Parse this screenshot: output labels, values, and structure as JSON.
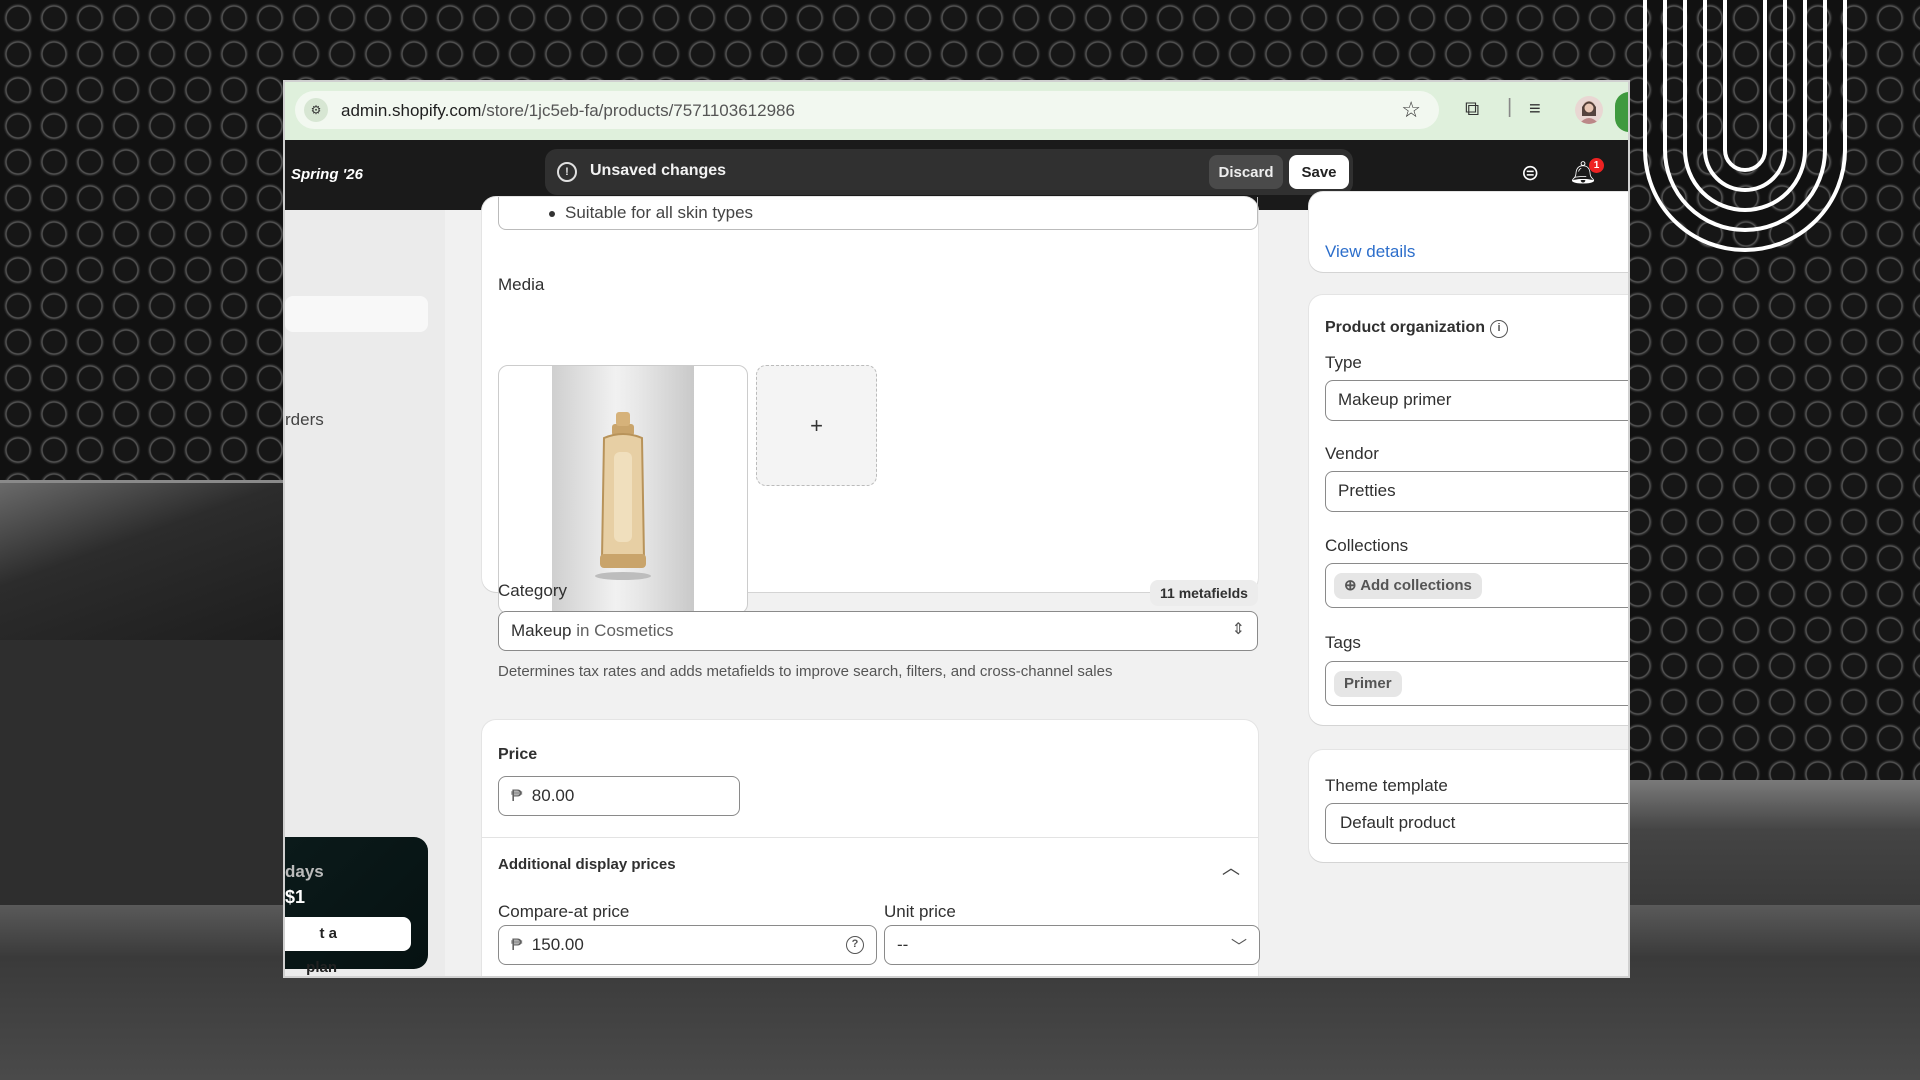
{
  "browser": {
    "url_domain": "admin.shopify.com",
    "url_path": "/store/1jc5eb-fa/products/7571103612986"
  },
  "topbar": {
    "brand": "Spring '26",
    "save_bar": {
      "message": "Unsaved changes",
      "discard_label": "Discard",
      "save_label": "Save"
    },
    "notification_count": "1"
  },
  "sidebar": {
    "orders_label": "rders",
    "trial": {
      "days_text": "days",
      "price_text": "$1",
      "button_label": "t a plan"
    }
  },
  "description": {
    "last_bullet": "Suitable for all skin types"
  },
  "media": {
    "label": "Media",
    "add_symbol": "+"
  },
  "category": {
    "label": "Category",
    "metafields_badge": "11 metafields",
    "value_main": "Makeup",
    "value_context": "in Cosmetics",
    "helper_text": "Determines tax rates and adds metafields to improve search, filters, and cross-channel sales"
  },
  "pricing": {
    "price_label": "Price",
    "currency_symbol": "₱",
    "price_value": "80.00",
    "additional_label": "Additional display prices",
    "compare_at_label": "Compare-at price",
    "compare_at_value": "150.00",
    "unit_price_label": "Unit price",
    "unit_price_value": "--"
  },
  "right_column": {
    "view_details": "View details",
    "product_org_title": "Product organization",
    "type_label": "Type",
    "type_value": "Makeup primer",
    "vendor_label": "Vendor",
    "vendor_value": "Pretties",
    "collections_label": "Collections",
    "add_collections": "Add collections",
    "tags_label": "Tags",
    "tag_primer": "Primer",
    "theme_template_label": "Theme template",
    "theme_template_value": "Default product"
  },
  "icons": {
    "site_info": "tune-icon",
    "bookmark": "star-icon",
    "extensions": "puzzle-icon",
    "media_controls": "playlist-icon",
    "store": "store-icon",
    "bell": "bell-icon"
  },
  "colors": {
    "link": "#2c6ecb",
    "topbar": "#1a1a1a",
    "chrome": "#dff0dc",
    "badge": "#e22222"
  }
}
